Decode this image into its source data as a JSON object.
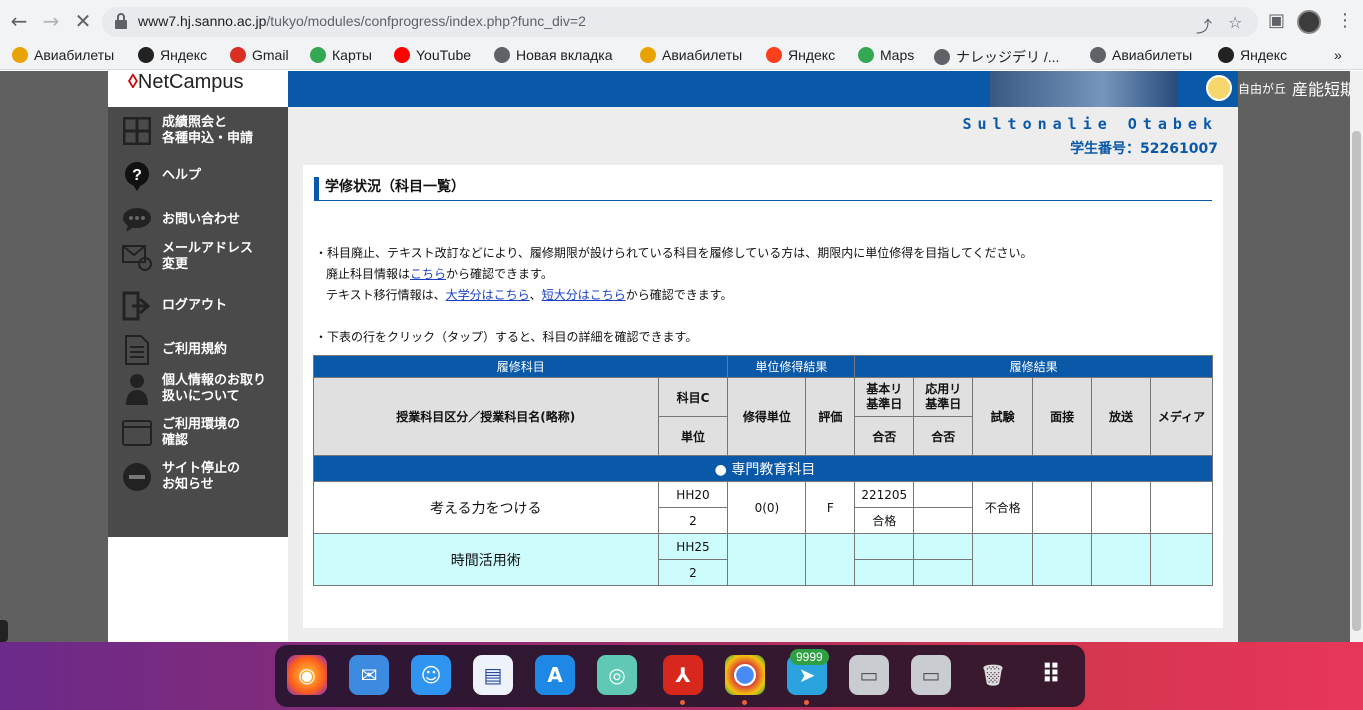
{
  "browser": {
    "url_host": "www7.hj.sanno.ac.jp",
    "url_path": "/tukyo/modules/confprogress/index.php?func_div=2",
    "bookmarks": [
      {
        "label": "Авиабилеты",
        "icon": "plane-icon",
        "color": "#e8a300"
      },
      {
        "label": "Яндекс",
        "icon": "yandex-icon",
        "color": "#222222"
      },
      {
        "label": "Gmail",
        "icon": "gmail-icon",
        "color": "#d93025"
      },
      {
        "label": "Карты",
        "icon": "maps-pin-icon",
        "color": "#34a853"
      },
      {
        "label": "YouTube",
        "icon": "youtube-icon",
        "color": "#ff0000"
      },
      {
        "label": "Новая вкладка",
        "icon": "globe-icon",
        "color": "#5f6368"
      },
      {
        "label": "Авиабилеты",
        "icon": "plane-icon",
        "color": "#e8a300"
      },
      {
        "label": "Яндекс",
        "icon": "yandex-icon",
        "color": "#fc3f1d"
      },
      {
        "label": "Maps",
        "icon": "maps-pin-icon",
        "color": "#34a853"
      },
      {
        "label": "ナレッジデリ /...",
        "icon": "globe-icon",
        "color": "#5f6368"
      },
      {
        "label": "Авиабилеты",
        "icon": "globe-icon",
        "color": "#5f6368"
      },
      {
        "label": "Яндекс",
        "icon": "yandex-icon",
        "color": "#222222"
      }
    ],
    "more": "»"
  },
  "site": {
    "logo": "NetCampus",
    "univ_small": "自由が丘",
    "univ_name": "産能短期大学",
    "student_name": "Sultonalie Otabek",
    "student_id": "学生番号：52261007"
  },
  "sidebar": [
    {
      "label": "成績照会と\n各種申込・申請",
      "icon": "grid-icon"
    },
    {
      "label": "ヘルプ",
      "icon": "help-icon"
    },
    {
      "label": "お問い合わせ",
      "icon": "chat-icon"
    },
    {
      "label": "メールアドレス\n変更",
      "icon": "mail-change-icon"
    },
    {
      "label": "ログアウト",
      "icon": "logout-icon"
    },
    {
      "label": "ご利用規約",
      "icon": "document-icon"
    },
    {
      "label": "個人情報のお取り\n扱いについて",
      "icon": "person-icon"
    },
    {
      "label": "ご利用環境の\n確認",
      "icon": "computer-icon"
    },
    {
      "label": "サイト停止の\nお知らせ",
      "icon": "stop-icon"
    }
  ],
  "content": {
    "title": "学修状況（科目一覧）",
    "note1": "・科目廃止、テキスト改訂などにより、履修期限が設けられている科目を履修している方は、期限内に単位修得を目指してください。",
    "note2_pre": "廃止科目情報は",
    "note2_link": "こちら",
    "note2_post": "から確認できます。",
    "note3_pre": "テキスト移行情報は、",
    "note3_link1": "大学分はこちら",
    "note3_sep": "、",
    "note3_link2": "短大分はこちら",
    "note3_post": "から確認できます。",
    "note4": "・下表の行をクリック（タップ）すると、科目の詳細を確認できます。"
  },
  "table": {
    "group_headers": {
      "a": "履修科目",
      "b": "単位修得結果",
      "c": "履修結果"
    },
    "headers": {
      "subject": "授業科目区分／授業科目名(略称)",
      "code": "科目C",
      "units": "単位",
      "earned": "修得単位",
      "grade": "評価",
      "basic_date": "基本リ\n基準日",
      "applied_date": "応用リ\n基準日",
      "basic_pass": "合否",
      "applied_pass": "合否",
      "exam": "試験",
      "interview": "面接",
      "broadcast": "放送",
      "media": "メディア"
    },
    "section": "● 専門教育科目",
    "rows": [
      {
        "name": "考える力をつける",
        "code": "HH20",
        "units": "2",
        "earned": "0(0)",
        "grade": "F",
        "basic_date": "221205",
        "basic_pass": "合格",
        "applied_date": "",
        "applied_pass": "",
        "exam": "不合格",
        "interview": "",
        "broadcast": "",
        "media": ""
      },
      {
        "name": "時間活用術",
        "code": "HH25",
        "units": "2",
        "earned": "",
        "grade": "",
        "basic_date": "",
        "basic_pass": "",
        "applied_date": "",
        "applied_pass": "",
        "exam": "",
        "interview": "",
        "broadcast": "",
        "media": ""
      }
    ]
  },
  "dock": {
    "badge": "9999"
  }
}
